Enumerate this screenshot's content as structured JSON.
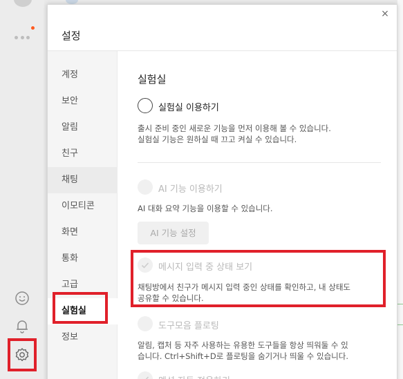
{
  "dialog": {
    "title": "설정",
    "close_label": "×"
  },
  "sidebar": {
    "items": [
      {
        "label": "계정"
      },
      {
        "label": "보안"
      },
      {
        "label": "알림"
      },
      {
        "label": "친구"
      },
      {
        "label": "채팅"
      },
      {
        "label": "이모티콘"
      },
      {
        "label": "화면"
      },
      {
        "label": "통화"
      },
      {
        "label": "고급"
      },
      {
        "label": "실험실"
      },
      {
        "label": "정보"
      }
    ],
    "active": "실험실"
  },
  "content": {
    "title": "실험실",
    "options": [
      {
        "label": "실험실 이용하기",
        "control": "radio",
        "enabled": true,
        "description_lines": [
          "출시 준비 중인 새로운 기능을 먼저 이용해 볼 수 있습니다.",
          "실험실 기능은 원하실 때 끄고 켜실 수 있습니다."
        ]
      },
      {
        "label": "AI 기능 이용하기",
        "control": "radio",
        "enabled": false,
        "description_lines": [
          "AI 대화 요약 기능을 이용할 수 있습니다."
        ],
        "button_label": "AI 기능 설정"
      },
      {
        "label": "메시지 입력 중 상태 보기",
        "control": "check",
        "enabled": false,
        "description_lines": [
          "채팅방에서 친구가 메시지 입력 중인 상태를 확인하고, 내 상태도",
          "공유할 수 있습니다."
        ]
      },
      {
        "label": "도구모음 플로팅",
        "control": "radio",
        "enabled": false,
        "description_lines": [
          "알림, 캡처 등 자주 사용하는 유용한 도구들을 항상 띄워둘 수 있",
          "습니다. Ctrl+Shift+D로 플로팅을 숨기거나 띄울 수 있습니다."
        ]
      },
      {
        "label": "멘션 자동 적용하기",
        "control": "check",
        "enabled": false
      }
    ]
  },
  "colors": {
    "highlight": "#e0202a",
    "badge": "#ff5a1f",
    "sidebar_bg": "#f5f5f5"
  },
  "icons": {
    "rail": [
      "chat-icon",
      "more-icon",
      "emoji-icon",
      "bell-icon",
      "gear-icon"
    ],
    "dialog": [
      "close-icon",
      "checkmark-icon"
    ]
  }
}
